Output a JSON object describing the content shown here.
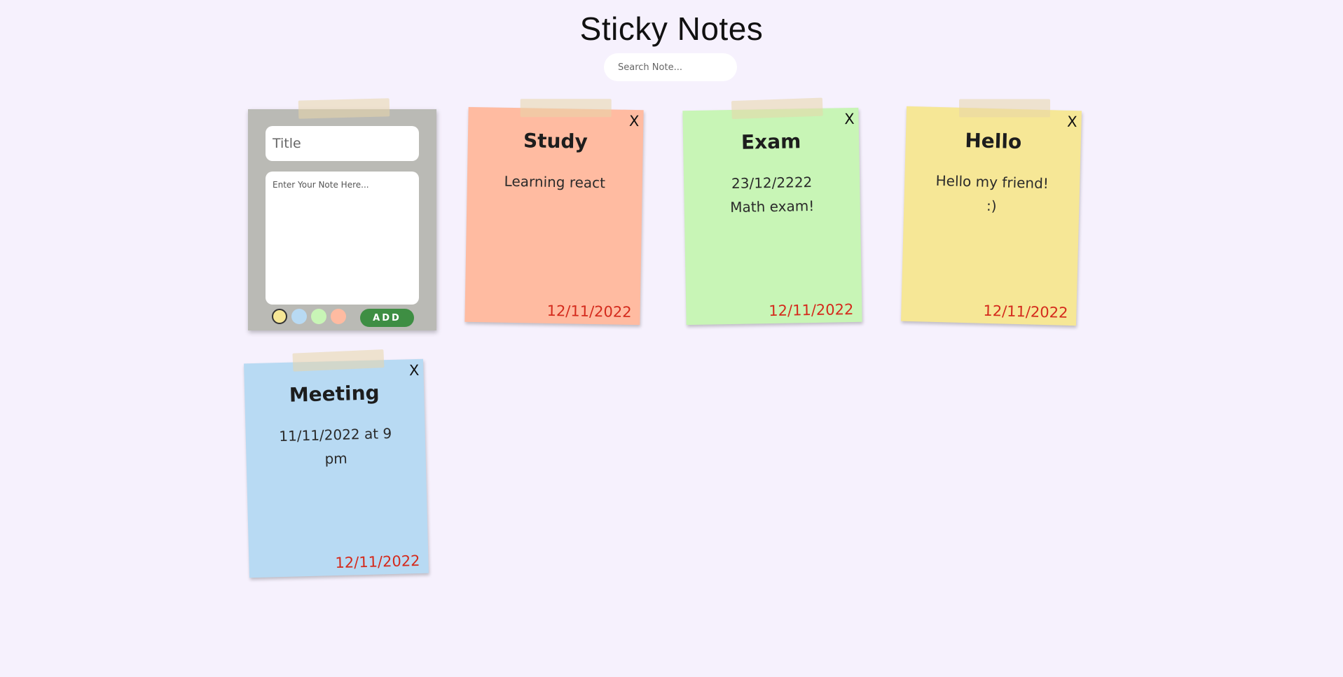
{
  "header": {
    "title": "Sticky Notes",
    "search_placeholder": "Search Note..."
  },
  "composer": {
    "title_placeholder": "Title",
    "body_placeholder": "Enter Your Note Here...",
    "add_label": "ADD",
    "colors": [
      "#f6e796",
      "#b8daf3",
      "#c8f5b6",
      "#ffbba1"
    ],
    "selected_color": "#f6e796"
  },
  "notes": [
    {
      "title": "Study",
      "body": "Learning react",
      "date": "12/11/2022",
      "color": "#ffbba1",
      "close": "X"
    },
    {
      "title": "Exam",
      "body": "23/12/2222 Math exam!",
      "date": "12/11/2022",
      "color": "#c8f5b6",
      "close": "X"
    },
    {
      "title": "Hello",
      "body": "Hello my friend! :)",
      "date": "12/11/2022",
      "color": "#f6e796",
      "close": "X"
    },
    {
      "title": "Meeting",
      "body": "11/11/2022 at 9 pm",
      "date": "12/11/2022",
      "color": "#b8daf3",
      "close": "X"
    }
  ]
}
